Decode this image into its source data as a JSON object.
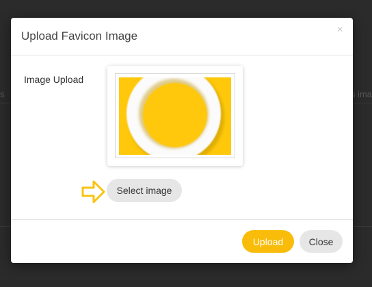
{
  "background_page": {
    "left_fragment": "s",
    "right_fragment": "s ima"
  },
  "modal": {
    "title": "Upload Favicon Image",
    "close_icon": "×",
    "field_label": "Image Upload",
    "preview": {
      "image_description_icon": "yellow-ring-favicon",
      "image_bg_color": "#ffc80a"
    },
    "select_button_label": "Select image",
    "pointer_arrow_icon": "arrow-right-outline-icon",
    "accent_color": "#f9bc0b",
    "footer": {
      "upload_label": "Upload",
      "close_label": "Close"
    }
  }
}
